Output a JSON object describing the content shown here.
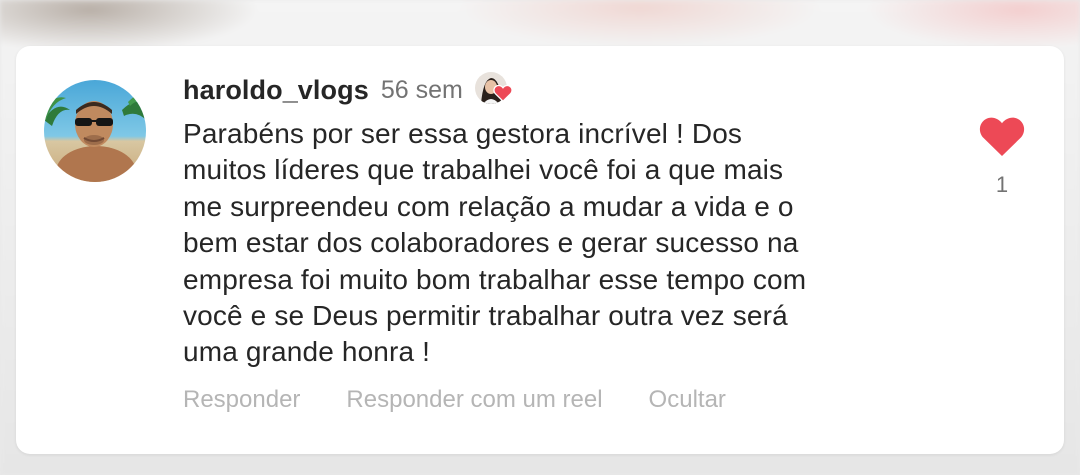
{
  "comment": {
    "username": "haroldo_vlogs",
    "time": "56 sem",
    "text": "Parabéns por ser essa gestora incrível ! Dos\nmuitos líderes que trabalhei você foi a que mais\nme surpreendeu com relação a mudar a vida e o\nbem estar dos colaboradores e gerar sucesso na\nempresa foi muito bom trabalhar esse tempo com\nvocê e se Deus permitir trabalhar outra vez será\numa grande honra !",
    "like_count": "1",
    "liked_by_author_icon": "author-like-avatar-icon",
    "heart_icon": "heart-filled-icon"
  },
  "actions": {
    "reply": "Responder",
    "reply_reel": "Responder com um reel",
    "hide": "Ocultar"
  },
  "colors": {
    "heart": "#ed4956",
    "text": "#262626",
    "secondary": "#737373",
    "action": "#b5b5b5"
  }
}
